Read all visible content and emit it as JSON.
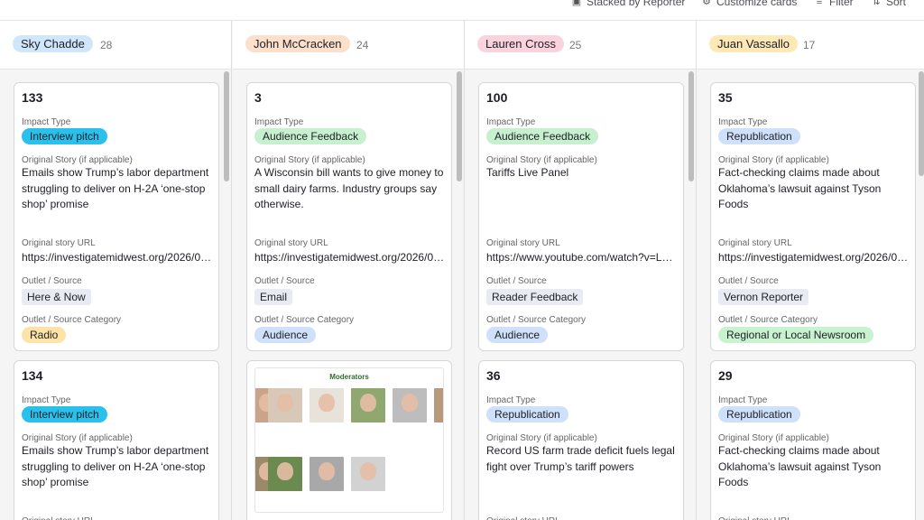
{
  "toolbar": {
    "stacked_label": "Stacked by Reporter",
    "customize_label": "Customize cards",
    "filter_label": "Filter",
    "sort_label": "Sort"
  },
  "field_labels": {
    "impact_type": "Impact Type",
    "original_story": "Original Story (if applicable)",
    "original_url": "Original story URL",
    "outlet_source": "Outlet / Source",
    "outlet_category": "Outlet / Source Category"
  },
  "columns": [
    {
      "name": "Sky Chadde",
      "count": "28",
      "cards": [
        {
          "id": "133",
          "impact_type": "Interview pitch",
          "original_story": "Emails show Trump’s labor department struggling to deliver on H-2A ‘one-stop shop’ promise",
          "url": "https://investigatemidwest.org/2026/03...",
          "outlet": "Here & Now",
          "category": "Radio"
        },
        {
          "id": "134",
          "impact_type": "Interview pitch",
          "original_story": "Emails show Trump’s labor department struggling to deliver on H-2A ‘one-stop shop’ promise"
        }
      ]
    },
    {
      "name": "John McCracken",
      "count": "24",
      "cards": [
        {
          "id": "3",
          "impact_type": "Audience Feedback",
          "original_story": "A Wisconsin bill wants to give money to small dairy farms. Industry groups say otherwise.",
          "url": "https://investigatemidwest.org/2026/01...",
          "outlet": "Email",
          "category": "Audience"
        },
        {
          "attachment_title": "Moderators"
        }
      ]
    },
    {
      "name": "Lauren Cross",
      "count": "25",
      "cards": [
        {
          "id": "100",
          "impact_type": "Audience Feedback",
          "original_story": "Tariffs Live Panel",
          "url": "https://www.youtube.com/watch?v=LQ...",
          "outlet": "Reader Feedback",
          "category": "Audience"
        },
        {
          "id": "36",
          "impact_type": "Republication",
          "original_story": "Record US farm trade deficit fuels legal fight over Trump’s tariff powers"
        }
      ]
    },
    {
      "name": "Juan Vassallo",
      "count": "17",
      "cards": [
        {
          "id": "35",
          "impact_type": "Republication",
          "original_story": "Fact-checking claims made about Oklahoma’s lawsuit against Tyson Foods",
          "url": "https://investigatemidwest.org/2026/01...",
          "outlet": "Vernon Reporter",
          "category": "Regional or Local Newsroom"
        },
        {
          "id": "29",
          "impact_type": "Republication",
          "original_story": "Fact-checking claims made about Oklahoma’s lawsuit against Tyson Foods"
        }
      ]
    }
  ],
  "icons": {
    "stacked": "stack-icon",
    "customize": "customize-icon",
    "filter": "filter-icon",
    "sort": "sort-icon"
  }
}
